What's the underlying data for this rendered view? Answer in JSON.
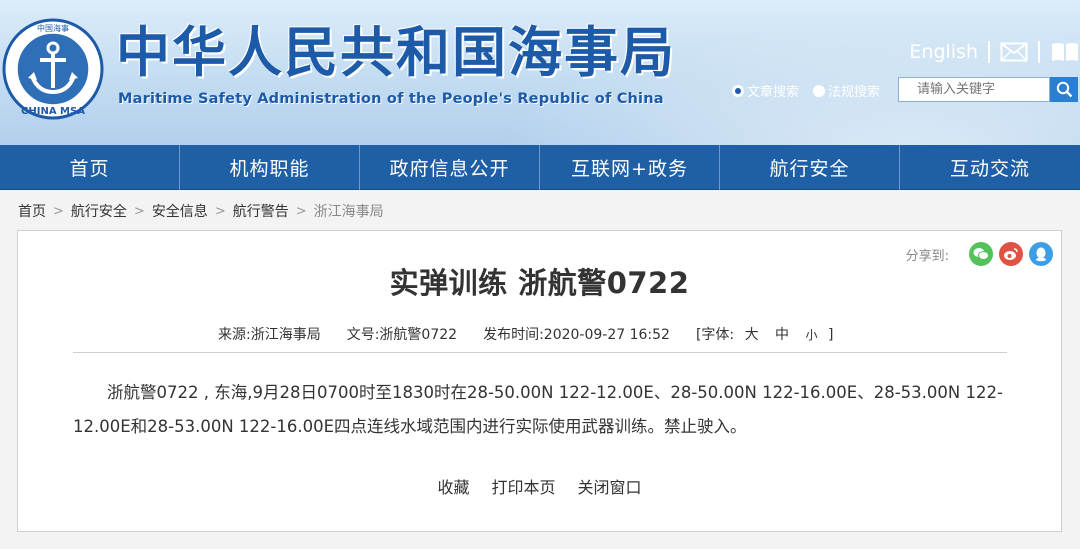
{
  "header": {
    "title": "中华人民共和国海事局",
    "subtitle": "Maritime Safety Administration of the People's Republic of China",
    "logo_text": "CHINA MSA",
    "logo_ring_text": "中国海事",
    "english_link": "English",
    "search": {
      "option_article": "文章搜索",
      "option_regulation": "法规搜索",
      "placeholder": "请输入关键字"
    }
  },
  "nav": [
    {
      "label": "首页"
    },
    {
      "label": "机构职能"
    },
    {
      "label": "政府信息公开"
    },
    {
      "label": "互联网+政务"
    },
    {
      "label": "航行安全"
    },
    {
      "label": "互动交流"
    }
  ],
  "breadcrumb": [
    "首页",
    "航行安全",
    "安全信息",
    "航行警告",
    "浙江海事局"
  ],
  "article": {
    "share_label": "分享到:",
    "title": "实弹训练 浙航警0722",
    "source": "来源:浙江海事局",
    "doc_no": "文号:浙航警0722",
    "publish_time": "发布时间:2020-09-27 16:52",
    "font_label": "[字体:",
    "font_large": "大",
    "font_medium": "中",
    "font_small": "小",
    "font_close": "]",
    "body": "浙航警0722 , 东海,9月28日0700时至1830时在28-50.00N 122-12.00E、28-50.00N 122-16.00E、28-53.00N 122-12.00E和28-53.00N 122-16.00E四点连线水域范围内进行实际使用武器训练。禁止驶入。",
    "actions": {
      "favorite": "收藏",
      "print": "打印本页",
      "close": "关闭窗口"
    }
  },
  "colors": {
    "brand_blue": "#1f5fa6",
    "title_blue": "#1d5aa8",
    "wechat": "#55c15a",
    "weibo": "#e05244",
    "qq": "#3d9ee8"
  }
}
